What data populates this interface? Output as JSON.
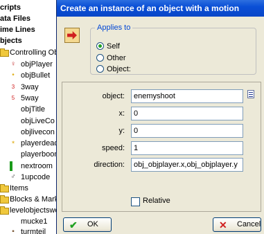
{
  "tree": {
    "items": [
      {
        "label": "cripts",
        "bold": true
      },
      {
        "label": "ata Files",
        "bold": true
      },
      {
        "label": "ime Lines",
        "bold": true
      },
      {
        "label": "bjects",
        "bold": true
      },
      {
        "label": "Controlling Ob",
        "bold": false
      },
      {
        "label": "objPlayer",
        "bold": false
      },
      {
        "label": "objBullet",
        "bold": false
      },
      {
        "label": "3way",
        "bold": false
      },
      {
        "label": "5way",
        "bold": false
      },
      {
        "label": "objTitle",
        "bold": false
      },
      {
        "label": "objLiveCo",
        "bold": false
      },
      {
        "label": "objlivecon",
        "bold": false
      },
      {
        "label": "playerdead",
        "bold": false
      },
      {
        "label": "playerboom",
        "bold": false
      },
      {
        "label": "nextroom",
        "bold": false
      },
      {
        "label": "1upcode",
        "bold": false
      },
      {
        "label": "Items",
        "bold": false
      },
      {
        "label": "Blocks & Mark",
        "bold": false
      },
      {
        "label": "levelobjectswo",
        "bold": false
      },
      {
        "label": "mucke1",
        "bold": false
      },
      {
        "label": "turmteil",
        "bold": false
      }
    ]
  },
  "dialog": {
    "title": "Create an instance of an object with a motion",
    "applies_to": {
      "legend": "Applies to",
      "options": [
        "Self",
        "Other",
        "Object:"
      ],
      "selected": "Self"
    },
    "params": {
      "object_label": "object:",
      "object_value": "enemyshoot",
      "x_label": "x:",
      "x_value": "0",
      "y_label": "y:",
      "y_value": "0",
      "speed_label": "speed:",
      "speed_value": "1",
      "direction_label": "direction:",
      "direction_value": "obj_objplayer.x,obj_objplayer.y"
    },
    "relative_label": "Relative",
    "relative_checked": false,
    "ok_label": "OK",
    "cancel_label": "Cancel"
  },
  "colors": {
    "titlebar": "#0a4fd6",
    "dialog_bg": "#ece9d8",
    "legend_text": "#0046d5",
    "ok_check": "#21a121",
    "cancel_x": "#d02020"
  }
}
